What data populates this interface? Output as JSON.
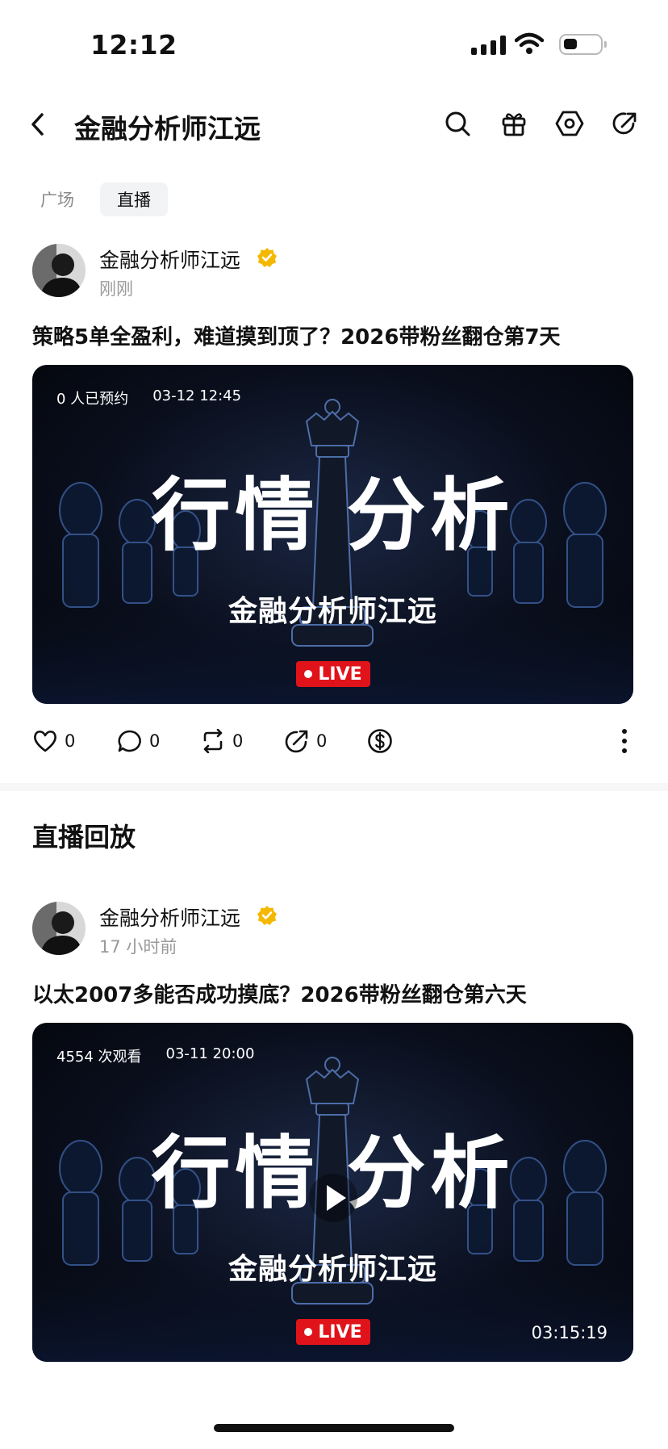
{
  "status_bar": {
    "time": "12:12"
  },
  "header": {
    "title": "金融分析师江远"
  },
  "tabs": [
    {
      "label": "广场",
      "active": false
    },
    {
      "label": "直播",
      "active": true
    }
  ],
  "posts": [
    {
      "author": "金融分析师江远",
      "time": "刚刚",
      "title": "策略5单全盈利，难道摸到顶了？2026带粉丝翻仓第7天",
      "card": {
        "stat": "0 人已预约",
        "date": "03-12 12:45",
        "big_title_1": "行情",
        "big_title_2": "分析",
        "sub_title": "金融分析师江远",
        "badge": "LIVE"
      },
      "actions": {
        "likes": "0",
        "comments": "0",
        "reposts": "0",
        "shares": "0"
      }
    },
    {
      "author": "金融分析师江远",
      "time": "17 小时前",
      "title": "以太2007多能否成功摸底？2026带粉丝翻仓第六天",
      "card": {
        "stat": "4554 次观看",
        "date": "03-11 20:00",
        "big_title_1": "行情",
        "big_title_2": "分析",
        "sub_title": "金融分析师江远",
        "badge": "LIVE",
        "duration": "03:15:19"
      }
    }
  ],
  "section": {
    "replay_title": "直播回放"
  },
  "colors": {
    "live_red": "#e0131b",
    "verified_gold": "#f5b800",
    "muted": "#9a9a9a"
  },
  "icons": [
    "back-icon",
    "search-icon",
    "gift-icon",
    "settings-icon",
    "share-icon",
    "heart-icon",
    "comment-icon",
    "repost-icon",
    "forward-icon",
    "tip-icon",
    "more-icon",
    "verified-icon",
    "play-icon"
  ]
}
